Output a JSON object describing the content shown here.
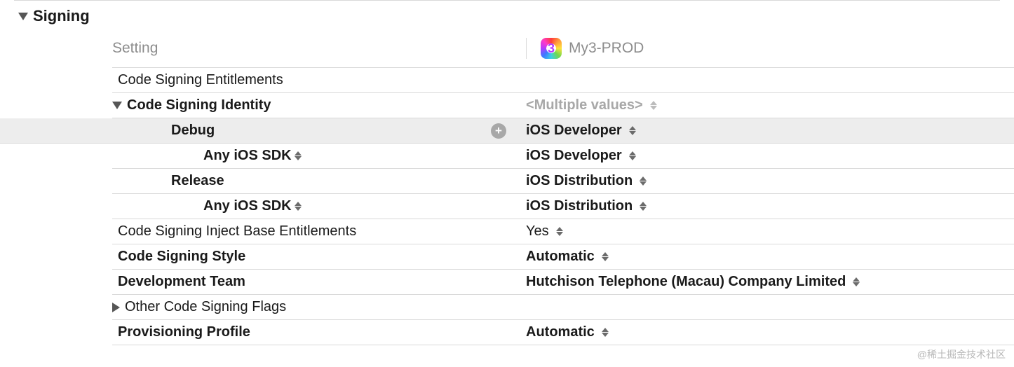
{
  "section": {
    "title": "Signing"
  },
  "columns": {
    "setting": "Setting",
    "target": "My3-PROD"
  },
  "rows": {
    "entitlements": {
      "label": "Code Signing Entitlements"
    },
    "identity": {
      "label": "Code Signing Identity",
      "value": "<Multiple values>"
    },
    "debug": {
      "label": "Debug",
      "value": "iOS Developer"
    },
    "debug_sdk": {
      "label": "Any iOS SDK",
      "value": "iOS Developer"
    },
    "release": {
      "label": "Release",
      "value": "iOS Distribution"
    },
    "release_sdk": {
      "label": "Any iOS SDK",
      "value": "iOS Distribution"
    },
    "inject": {
      "label": "Code Signing Inject Base Entitlements",
      "value": "Yes"
    },
    "style": {
      "label": "Code Signing Style",
      "value": "Automatic"
    },
    "team": {
      "label": "Development Team",
      "value": "Hutchison Telephone (Macau) Company Limited"
    },
    "other_flags": {
      "label": "Other Code Signing Flags"
    },
    "profile": {
      "label": "Provisioning Profile",
      "value": "Automatic"
    }
  },
  "watermark": "@稀土掘金技术社区"
}
